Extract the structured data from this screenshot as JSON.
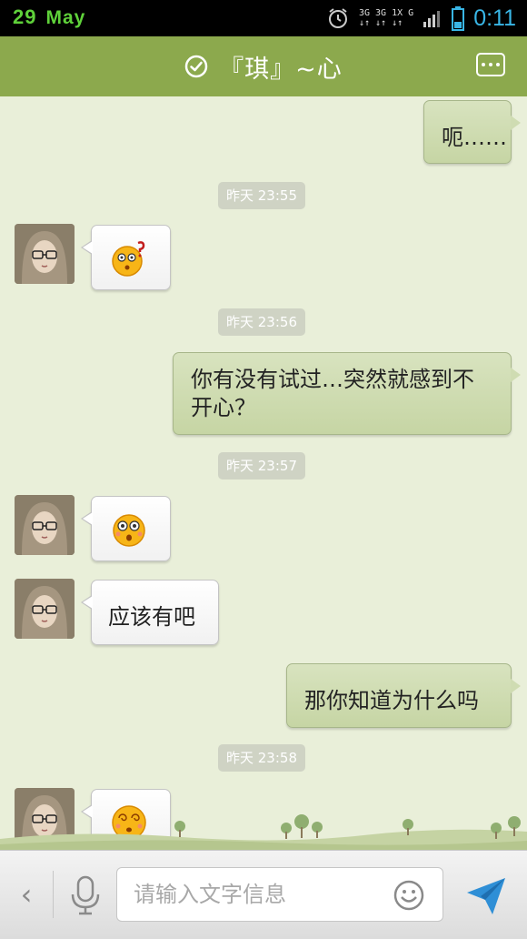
{
  "status_bar": {
    "day": "29",
    "month": "May",
    "network_top": "3G 3G 1X G",
    "time": "0:11"
  },
  "header": {
    "title": "『琪』~心",
    "check_icon": "check-circle-icon",
    "more_icon": "more-icon"
  },
  "messages": [
    {
      "type": "out",
      "text": "呃……"
    },
    {
      "type": "time",
      "text": "昨天 23:55"
    },
    {
      "type": "in",
      "emoji": "dizzy-question-emoji"
    },
    {
      "type": "time",
      "text": "昨天 23:56"
    },
    {
      "type": "out",
      "text": "你有没有试过…突然就感到不开心？",
      "line1": "你有没有试过…突然就感到不",
      "line2": "开心？"
    },
    {
      "type": "time",
      "text": "昨天 23:57"
    },
    {
      "type": "in",
      "emoji": "surprised-emoji"
    },
    {
      "type": "in",
      "text": "应该有吧"
    },
    {
      "type": "out",
      "text": "那你知道为什么吗"
    },
    {
      "type": "time",
      "text": "昨天 23:58"
    },
    {
      "type": "in",
      "emoji": "dizzy-emoji"
    }
  ],
  "input_bar": {
    "placeholder": "请输入文字信息",
    "back_icon": "chevron-left-icon",
    "mic_icon": "microphone-icon",
    "emoji_icon": "smiley-icon",
    "send_icon": "send-icon"
  },
  "colors": {
    "header": "#8ca94d",
    "chat_background": "#e9efd9",
    "outgoing_bubble": "#c6d5a4",
    "time_accent": "#39b6e6",
    "date_accent": "#5fd13a"
  }
}
